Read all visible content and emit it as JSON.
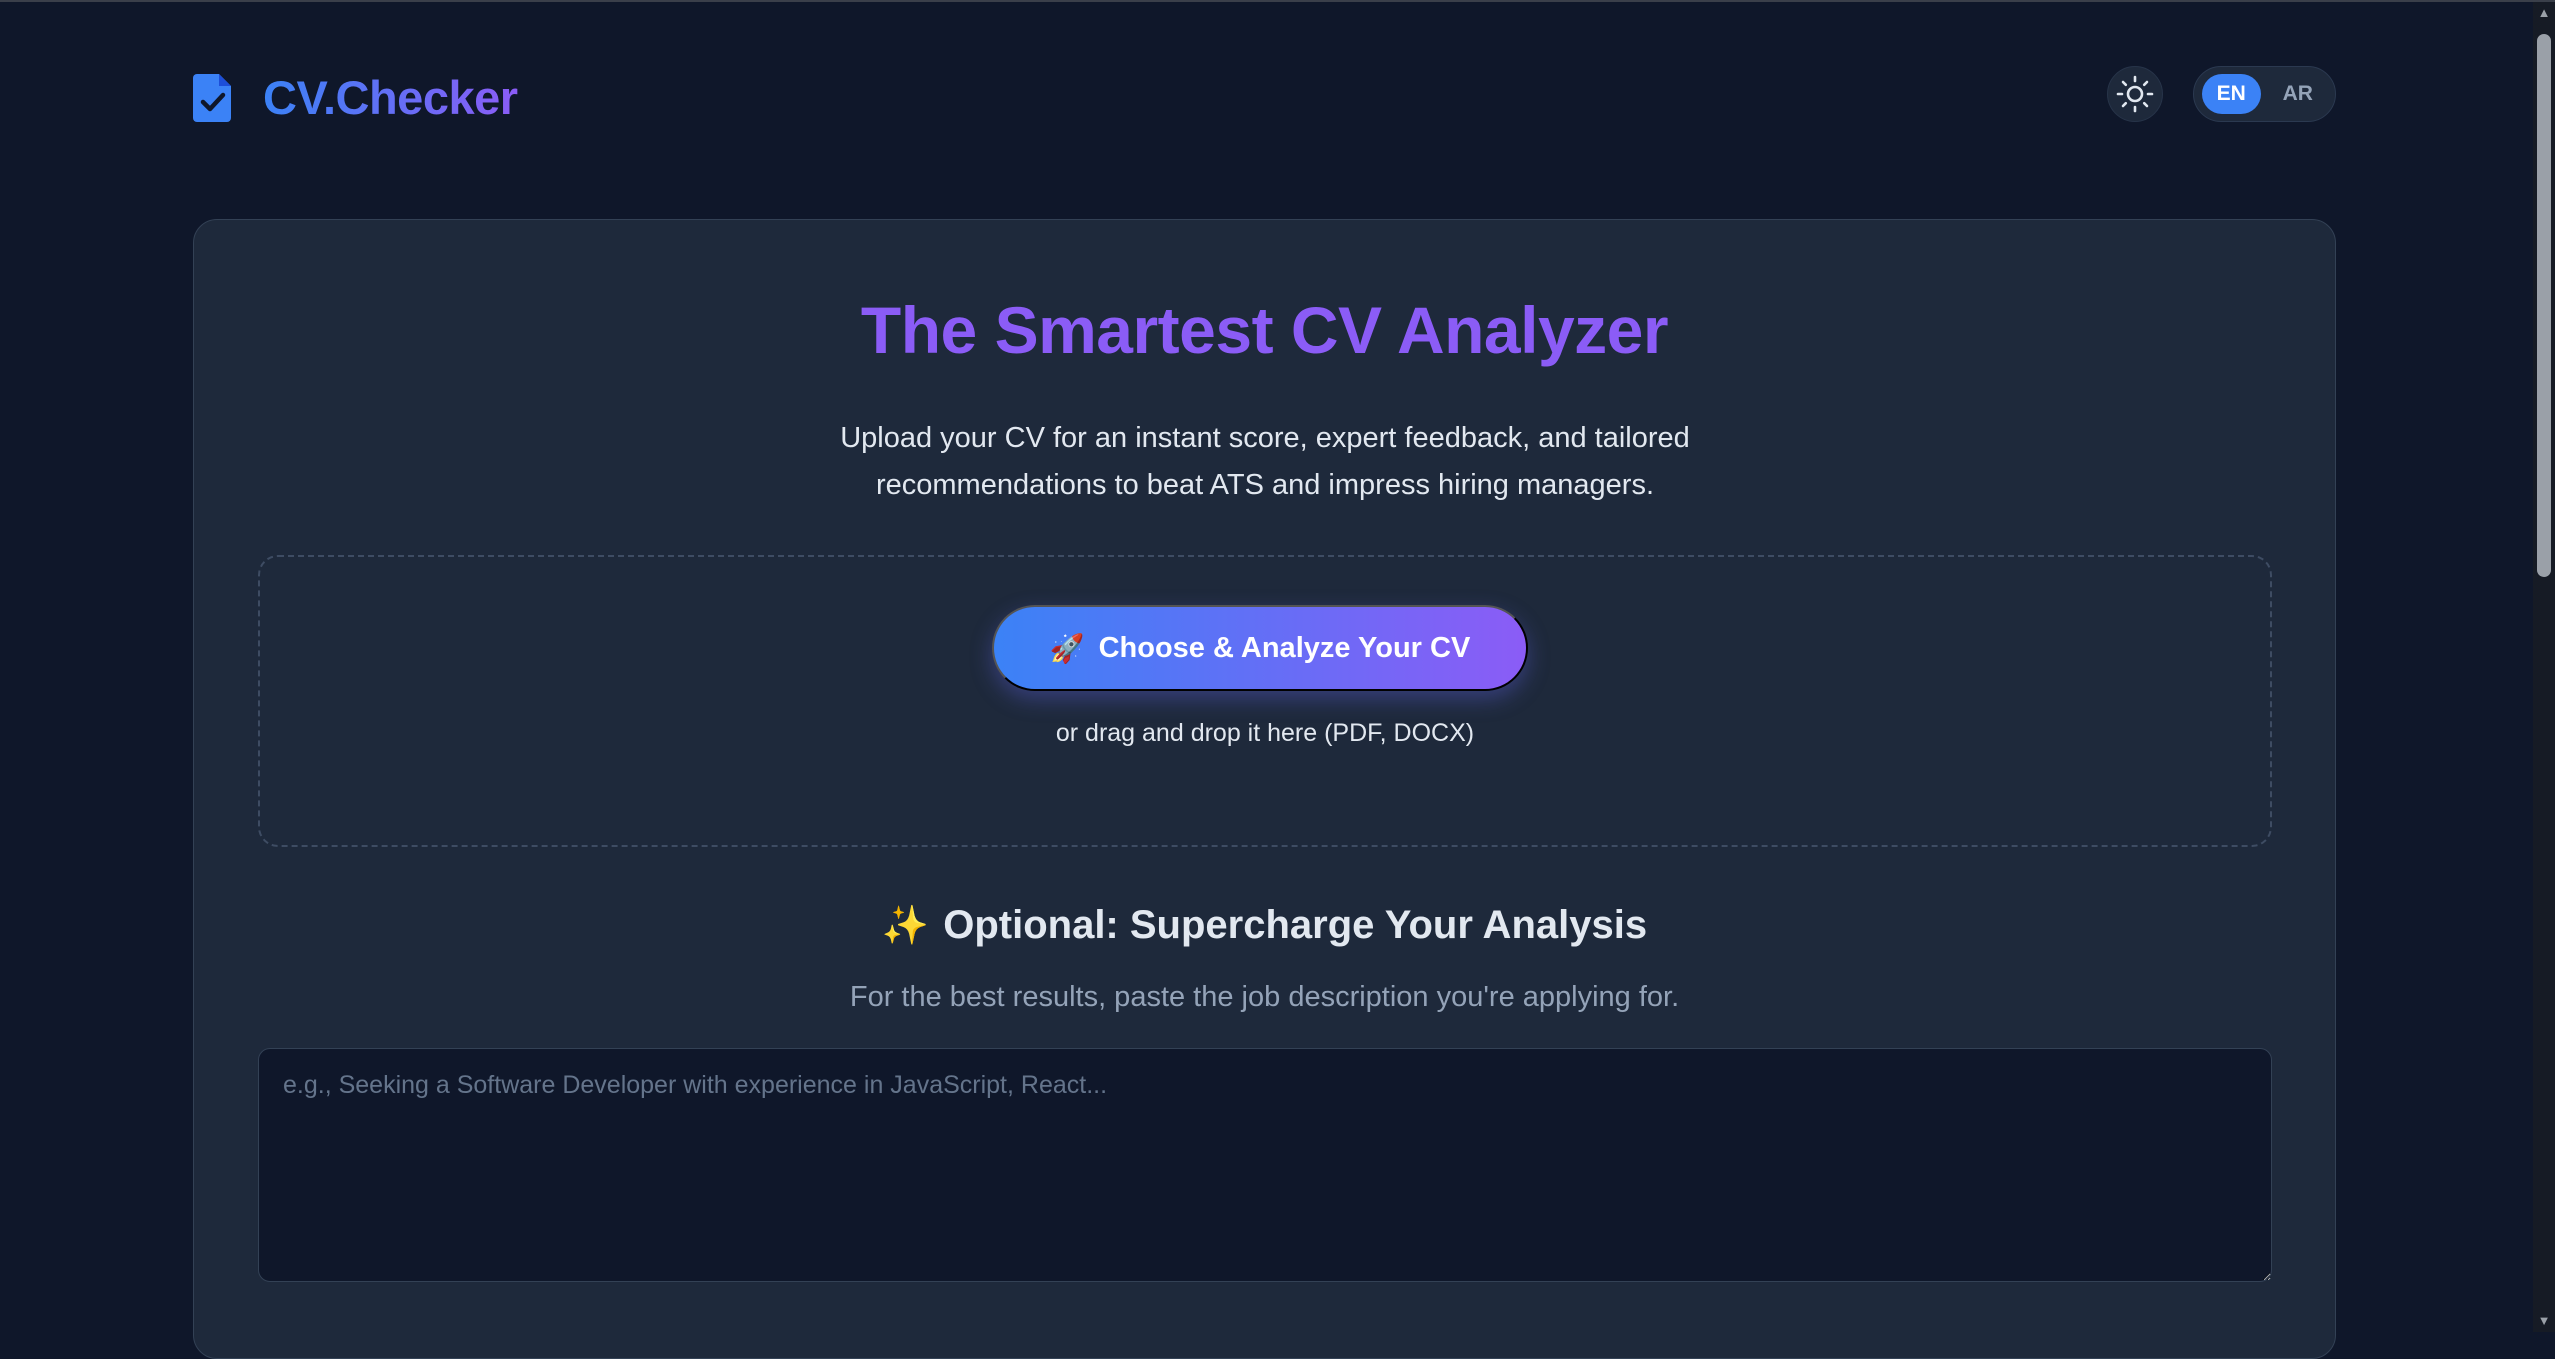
{
  "header": {
    "brand": "CV.Checker",
    "brand_icon": "file-check-icon",
    "theme_icon": "sun-icon",
    "languages": [
      {
        "label": "EN",
        "active": true
      },
      {
        "label": "AR",
        "active": false
      }
    ]
  },
  "hero": {
    "title": "The Smartest CV Analyzer",
    "subtitle": "Upload your CV for an instant score, expert feedback, and tailored recommendations to beat ATS and impress hiring managers."
  },
  "upload": {
    "button_icon": "🚀",
    "button_label": "Choose & Analyze Your CV",
    "hint": "or drag and drop it here (PDF, DOCX)"
  },
  "optional": {
    "icon": "✨",
    "title": "Optional: Supercharge Your Analysis",
    "subtitle": "For the best results, paste the job description you're applying for.",
    "placeholder": "e.g., Seeking a Software Developer with experience in JavaScript, React..."
  },
  "colors": {
    "background": "#0f172a",
    "card": "#1e293b",
    "accent_blue": "#3b82f6",
    "accent_purple": "#8b5cf6"
  }
}
